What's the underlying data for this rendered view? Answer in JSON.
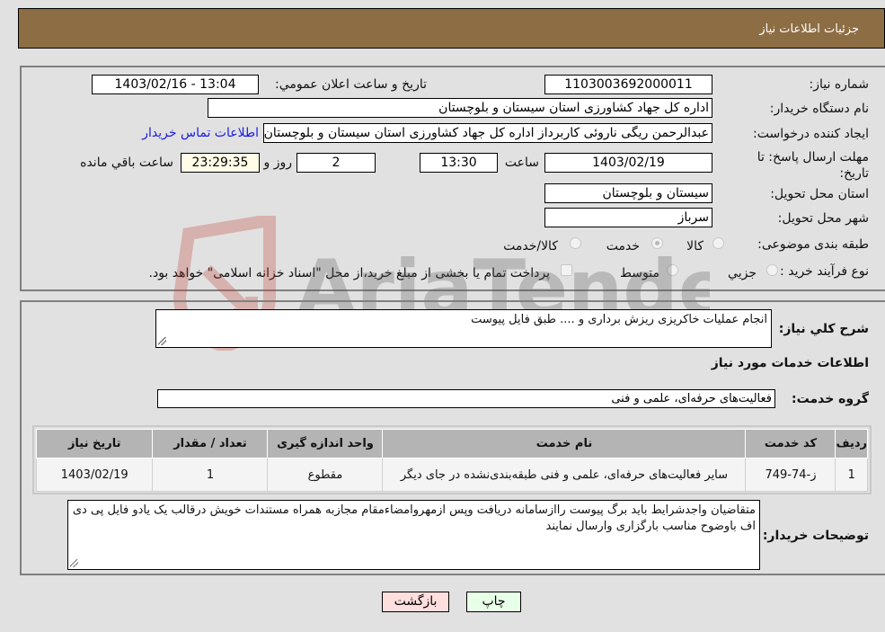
{
  "header": {
    "title": "جزئیات اطلاعات نیاز"
  },
  "details": {
    "need_number_label": "شماره نیاز:",
    "need_number": "1103003692000011",
    "announce_label": "تاریخ و ساعت اعلان عمومي:",
    "announce_value": "1403/02/16 - 13:04",
    "buyer_org_label": "نام دستگاه خریدار:",
    "buyer_org": "اداره کل جهاد کشاورزی استان سیستان و بلوچستان",
    "requester_label": "ایجاد کننده درخواست:",
    "requester": "عبدالرحمن ریگی ناروئی کاربرداز اداره کل جهاد کشاورزی استان سیستان و بلوچستان",
    "buyer_contact_link": "اطلاعات تماس خریدار",
    "deadline_label": "مهلت ارسال پاسخ: تا تاریخ:",
    "deadline_date": "1403/02/19",
    "time_label": "ساعت",
    "deadline_time": "13:30",
    "days_value": "2",
    "days_label": "روز و",
    "remaining_time": "23:29:35",
    "remaining_label": "ساعت باقي مانده",
    "province_label": "استان محل تحویل:",
    "province": "سیستان و بلوچستان",
    "city_label": "شهر محل تحویل:",
    "city": "سرباز",
    "category_label": "طبقه بندی موضوعی:",
    "category_options": [
      {
        "label": "کالا",
        "checked": false
      },
      {
        "label": "خدمت",
        "checked": true
      },
      {
        "label": "کالا/خدمت",
        "checked": false
      }
    ],
    "process_label": "نوع فرآیند خرید :",
    "process_options": [
      {
        "label": "جزيي",
        "checked": false
      },
      {
        "label": "متوسط",
        "checked": false
      }
    ],
    "payment_note": "پرداخت تمام یا بخشی از مبلغ خرید،از محل \"اسناد خزانه اسلامی\" خواهد بود."
  },
  "summary": {
    "label": "شرح کلي نیاز:",
    "text": "انجام عملیات خاکریزی ریزش برداری و .... طبق فایل پیوست"
  },
  "services": {
    "section_title": "اطلاعات خدمات مورد نیاز",
    "group_label": "گروه خدمت:",
    "group_value": "فعالیت‌های حرفه‌ای، علمی و فنی",
    "columns": [
      "ردیف",
      "کد خدمت",
      "نام خدمت",
      "واحد اندازه گیری",
      "تعداد / مقدار",
      "تاریخ نیاز"
    ],
    "rows": [
      {
        "row": "1",
        "code": "ز-74-749",
        "name": "سایر فعالیت‌های حرفه‌ای، علمی و فنی طبقه‌بندی‌نشده در جای دیگر",
        "unit": "مقطوع",
        "qty": "1",
        "date": "1403/02/19"
      }
    ]
  },
  "buyer_notes": {
    "label": "توضیحات خریدار:",
    "text": "متقاضیان واجدشرایط باید برگ پیوست راازسامانه دریافت وپس ازمهروامضاءمقام مجازبه همراه مستندات  خویش درقالب یک یادو فایل پی دی اف باوضوح مناسب بارگزاری وارسال نمایند"
  },
  "buttons": {
    "back": "بازگشت",
    "print": "چاپ"
  },
  "watermark": {
    "text": "AriaTender.net",
    "colors": {
      "logo": "#c0392b",
      "text": "#555555"
    }
  }
}
